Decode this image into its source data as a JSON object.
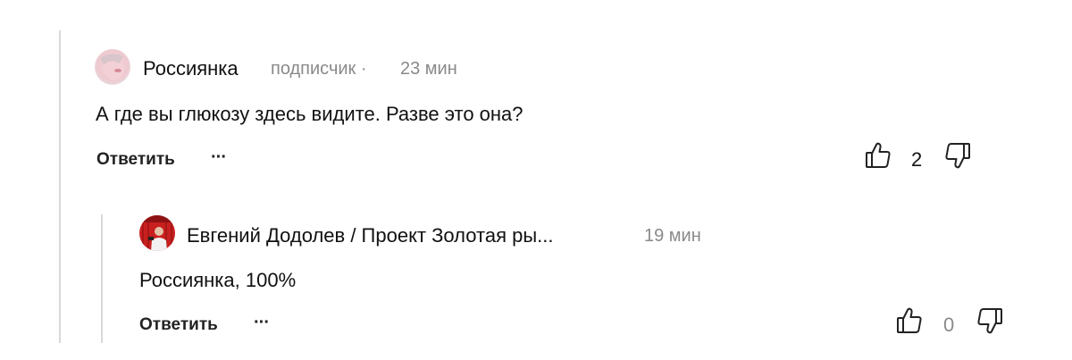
{
  "comments": [
    {
      "author": "Россиянка",
      "meta": "подписчик ·",
      "time": "23 мин",
      "text": "А где вы глюкозу  здесь видите. Разве это она?",
      "reply_label": "Ответить",
      "more_label": "···",
      "likes": "2",
      "colors": {
        "count": "#111111"
      }
    },
    {
      "author": "Евгений Додолев / Проект Золотая ры...",
      "meta": "",
      "time": "19 мин",
      "text": "Россиянка, 100%",
      "reply_label": "Ответить",
      "more_label": "···",
      "likes": "0",
      "colors": {
        "count": "#8a8a8a"
      }
    }
  ]
}
